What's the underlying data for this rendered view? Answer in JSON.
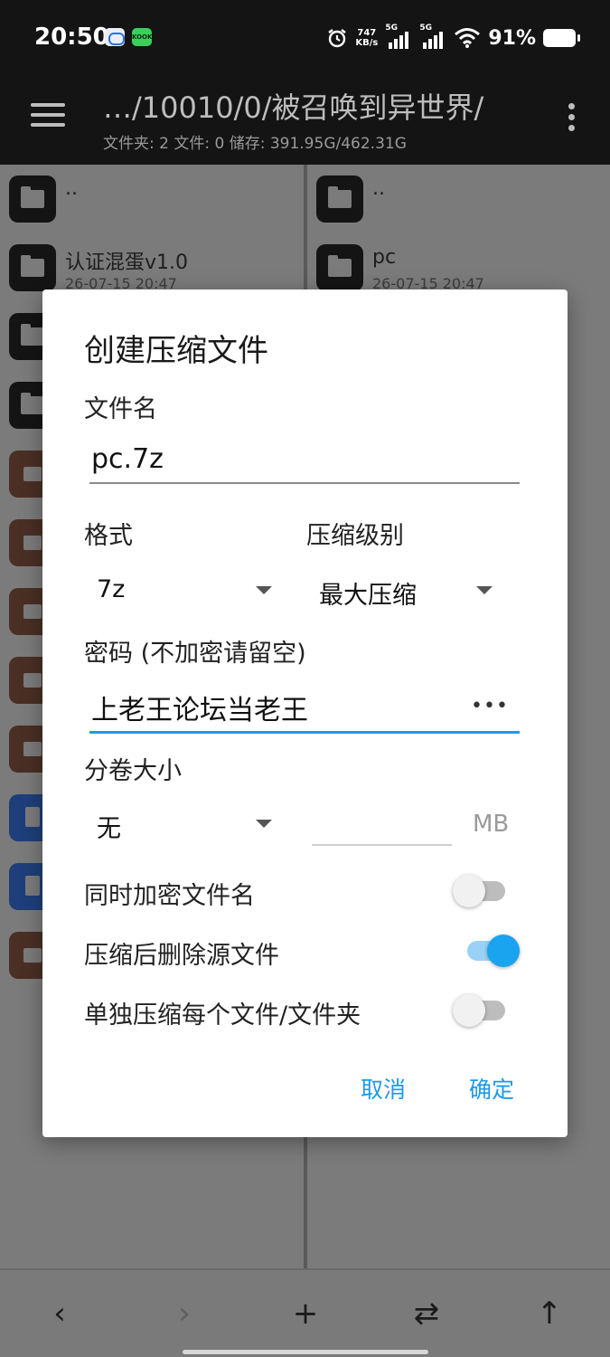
{
  "status_bar": {
    "time": "20:50",
    "app2_badge": "KOOK",
    "net_speed_value": "747",
    "net_speed_unit": "KB/s",
    "sig1": "5G",
    "sig2": "5G",
    "battery": "91%"
  },
  "app_bar": {
    "path": "…/10010/0/被召唤到异世界/",
    "summary": "文件夹: 2  文件: 0  储存: 391.95G/462.31G"
  },
  "left_pane": {
    "items": [
      {
        "name": "..",
        "date": "",
        "type": "folder"
      },
      {
        "name": "认证混蛋v1.0",
        "date": "26-07-15 20:47",
        "type": "folder"
      },
      {
        "name": "",
        "date": "",
        "type": "folder"
      },
      {
        "name": "",
        "date": "",
        "type": "folder"
      },
      {
        "name": "",
        "date": "",
        "type": "archive"
      },
      {
        "name": "",
        "date": "",
        "type": "archive"
      },
      {
        "name": "",
        "date": "",
        "type": "archive"
      },
      {
        "name": "",
        "date": "",
        "type": "archive"
      },
      {
        "name": "",
        "date": "",
        "type": "archive"
      },
      {
        "name": "",
        "date": "",
        "type": "doc"
      },
      {
        "name": "",
        "date": "",
        "type": "doc"
      },
      {
        "name": "",
        "date": "",
        "type": "archive"
      }
    ]
  },
  "right_pane": {
    "items": [
      {
        "name": "..",
        "date": "",
        "type": "folder"
      },
      {
        "name": "pc",
        "date": "26-07-15 20:47",
        "type": "folder"
      }
    ]
  },
  "dialog": {
    "title": "创建压缩文件",
    "filename_label": "文件名",
    "filename_value": "pc.7z",
    "format_label": "格式",
    "format_value": "7z",
    "level_label": "压缩级别",
    "level_value": "最大压缩",
    "password_label": "密码 (不加密请留空)",
    "password_value": "上老王论坛当老王",
    "password_toggle": "•••",
    "volume_label": "分卷大小",
    "volume_value": "无",
    "volume_size_value": "",
    "volume_unit": "MB",
    "options": [
      {
        "label": "同时加密文件名",
        "on": false
      },
      {
        "label": "压缩后删除源文件",
        "on": true
      },
      {
        "label": "单独压缩每个文件/文件夹",
        "on": false
      }
    ],
    "cancel_label": "取消",
    "ok_label": "确定"
  },
  "bottom_bar": {
    "back": "‹",
    "forward": "›",
    "add": "+",
    "swap": "⇄",
    "up": "↑"
  },
  "colors": {
    "accent": "#1e9ae8",
    "toggle_on_thumb": "#1aa3ef",
    "toggle_on_track": "#9ad2f7",
    "appbar_bg": "#141414",
    "scrim_pane": "#7b7b7b"
  }
}
